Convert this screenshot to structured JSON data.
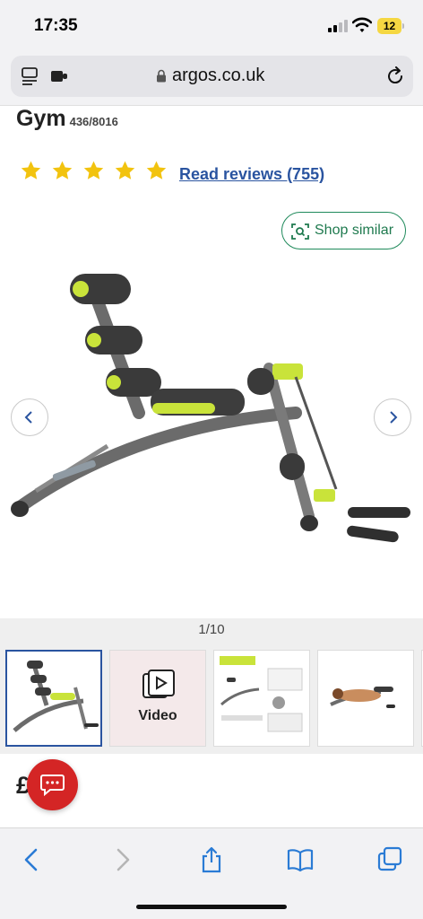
{
  "status_bar": {
    "time": "17:35",
    "battery": "12"
  },
  "browser": {
    "url": "argos.co.uk"
  },
  "product": {
    "title": "Gym",
    "code": "436/8016",
    "rating_stars": 5,
    "reviews_link": "Read reviews (755)",
    "shop_similar": "Shop similar",
    "image_pager": "1/10",
    "video_label": "Video",
    "price_visible": "£ 00"
  },
  "colors": {
    "accent_blue": "#2a54a0",
    "accent_green": "#1f8a5b",
    "star_yellow": "#f2c30f",
    "chat_red": "#d42525"
  },
  "icons": [
    "reader-icon",
    "extensions-icon",
    "lock-icon",
    "reload-icon",
    "star-icon",
    "shop-similar-icon",
    "chevron-left-icon",
    "chevron-right-icon",
    "play-icon",
    "chat-icon",
    "back-icon",
    "forward-icon",
    "share-icon",
    "bookmarks-icon",
    "tabs-icon"
  ]
}
